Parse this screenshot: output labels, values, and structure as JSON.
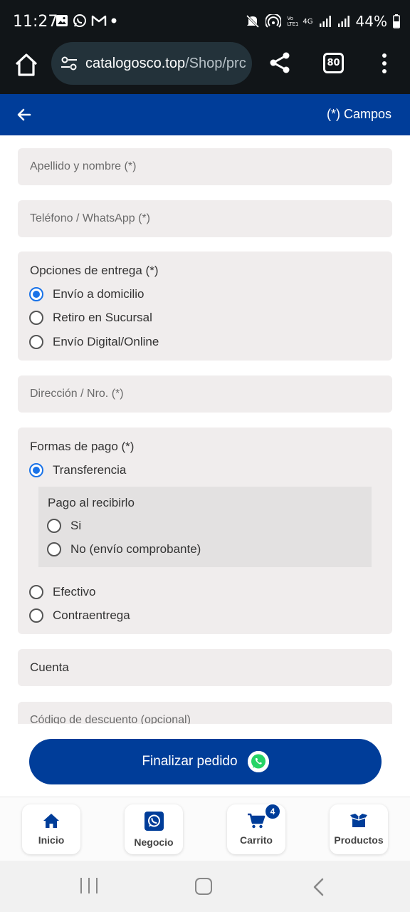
{
  "status_bar": {
    "time": "11:27",
    "battery": "44%",
    "network_label": "4G",
    "volte_label": "Vo LTE1"
  },
  "browser": {
    "url_host": "catalogosco.top",
    "url_path": "/Shop/prc",
    "tab_count": "80"
  },
  "header": {
    "note": "(*) Campos"
  },
  "form": {
    "name_placeholder": "Apellido y nombre (*)",
    "phone_placeholder": "Teléfono / WhatsApp (*)",
    "delivery": {
      "title": "Opciones de entrega (*)",
      "options": [
        {
          "label": "Envío a domicilio",
          "checked": true
        },
        {
          "label": "Retiro en Sucursal",
          "checked": false
        },
        {
          "label": "Envío Digital/Online",
          "checked": false
        }
      ]
    },
    "address_placeholder": "Dirección / Nro. (*)",
    "payment": {
      "title": "Formas de pago (*)",
      "options": [
        {
          "label": "Transferencia",
          "checked": true
        },
        {
          "label": "Efectivo",
          "checked": false
        },
        {
          "label": "Contraentrega",
          "checked": false
        }
      ],
      "sub": {
        "title": "Pago al recibirlo",
        "options": [
          {
            "label": "Si",
            "checked": false
          },
          {
            "label": "No (envío comprobante)",
            "checked": false
          }
        ]
      }
    },
    "account_value": "Cuenta",
    "discount_placeholder": "Código de descuento (opcional)"
  },
  "finalize": {
    "label": "Finalizar pedido"
  },
  "bottom_nav": {
    "items": [
      {
        "label": "Inicio",
        "icon": "home-icon"
      },
      {
        "label": "Negocio",
        "icon": "whatsapp-icon"
      },
      {
        "label": "Carrito",
        "icon": "cart-icon",
        "badge": "4"
      },
      {
        "label": "Productos",
        "icon": "box-icon"
      }
    ]
  },
  "colors": {
    "primary": "#003d99",
    "field_bg": "#f0eded",
    "radio_checked": "#1a73e8",
    "whatsapp_green": "#25d366"
  }
}
